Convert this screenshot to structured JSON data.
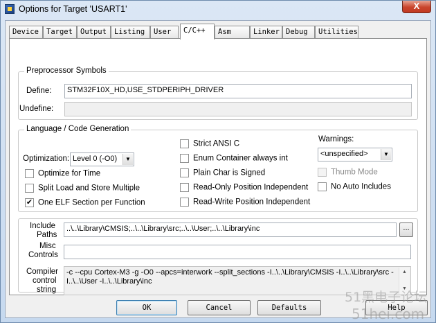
{
  "window": {
    "title": "Options for Target 'USART1'",
    "close_glyph": "X"
  },
  "tabs": [
    {
      "label": "Device"
    },
    {
      "label": "Target"
    },
    {
      "label": "Output"
    },
    {
      "label": "Listing"
    },
    {
      "label": "User"
    },
    {
      "label": "C/C++",
      "active": true
    },
    {
      "label": "Asm"
    },
    {
      "label": "Linker"
    },
    {
      "label": "Debug"
    },
    {
      "label": "Utilities"
    }
  ],
  "preprocessor": {
    "group_title": "Preprocessor Symbols",
    "define_label": "Define:",
    "define_value": "STM32F10X_HD,USE_STDPERIPH_DRIVER",
    "undefine_label": "Undefine:",
    "undefine_value": ""
  },
  "language": {
    "group_title": "Language / Code Generation",
    "optimization_label": "Optimization:",
    "optimization_value": "Level 0 (-O0)",
    "options": {
      "optimize_time": {
        "label": "Optimize for Time",
        "checked": false
      },
      "split_load": {
        "label": "Split Load and Store Multiple",
        "checked": false
      },
      "one_elf": {
        "label": "One ELF Section per Function",
        "checked": true
      },
      "strict_ansi": {
        "label": "Strict ANSI C",
        "checked": false
      },
      "enum_container": {
        "label": "Enum Container always int",
        "checked": false
      },
      "plain_char": {
        "label": "Plain Char is Signed",
        "checked": false
      },
      "ro_pos_indep": {
        "label": "Read-Only Position Independent",
        "checked": false
      },
      "rw_pos_indep": {
        "label": "Read-Write Position Independent",
        "checked": false
      },
      "thumb_mode": {
        "label": "Thumb Mode",
        "checked": false,
        "disabled": true
      },
      "no_auto_includes": {
        "label": "No Auto Includes",
        "checked": false
      }
    },
    "warnings_label": "Warnings:",
    "warnings_value": "<unspecified>"
  },
  "paths": {
    "include_label_1": "Include",
    "include_label_2": "Paths",
    "include_value": "..\\..\\Library\\CMSIS;..\\..\\Library\\src;..\\..\\User;..\\..\\Library\\inc",
    "browse_label": "...",
    "misc_label_1": "Misc",
    "misc_label_2": "Controls",
    "misc_value": "",
    "compiler_label_1": "Compiler",
    "compiler_label_2": "control",
    "compiler_label_3": "string",
    "compiler_value": "-c --cpu Cortex-M3 -g -O0 --apcs=interwork --split_sections -I..\\..\\Library\\CMSIS -I..\\..\\Library\\src -I..\\..\\User -I..\\..\\Library\\inc"
  },
  "buttons": {
    "ok": "OK",
    "cancel": "Cancel",
    "defaults": "Defaults",
    "help": "Help"
  },
  "watermark": {
    "line1": "51黑电子论坛",
    "line2": "51hei.com"
  },
  "colors": {
    "title_bar": "#c9dcf0",
    "close_button": "#c9452e",
    "dialog_bg": "#f0f0f0"
  }
}
